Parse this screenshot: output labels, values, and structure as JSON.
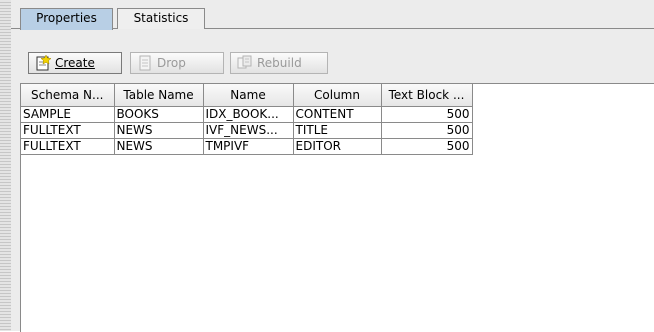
{
  "tabs": [
    {
      "label": "Properties",
      "active": true
    },
    {
      "label": "Statistics",
      "active": false
    }
  ],
  "toolbar": {
    "create_label": "Create",
    "drop_label": "Drop",
    "rebuild_label": "Rebuild"
  },
  "table": {
    "columns": [
      "Schema N...",
      "Table Name",
      "Name",
      "Column",
      "Text Block ..."
    ],
    "rows": [
      [
        "SAMPLE",
        "BOOKS",
        "IDX_BOOK...",
        "CONTENT",
        "500"
      ],
      [
        "FULLTEXT",
        "NEWS",
        "IVF_NEWS...",
        "TITLE",
        "500"
      ],
      [
        "FULLTEXT",
        "NEWS",
        "TMPIVF",
        "EDITOR",
        "500"
      ]
    ]
  }
}
